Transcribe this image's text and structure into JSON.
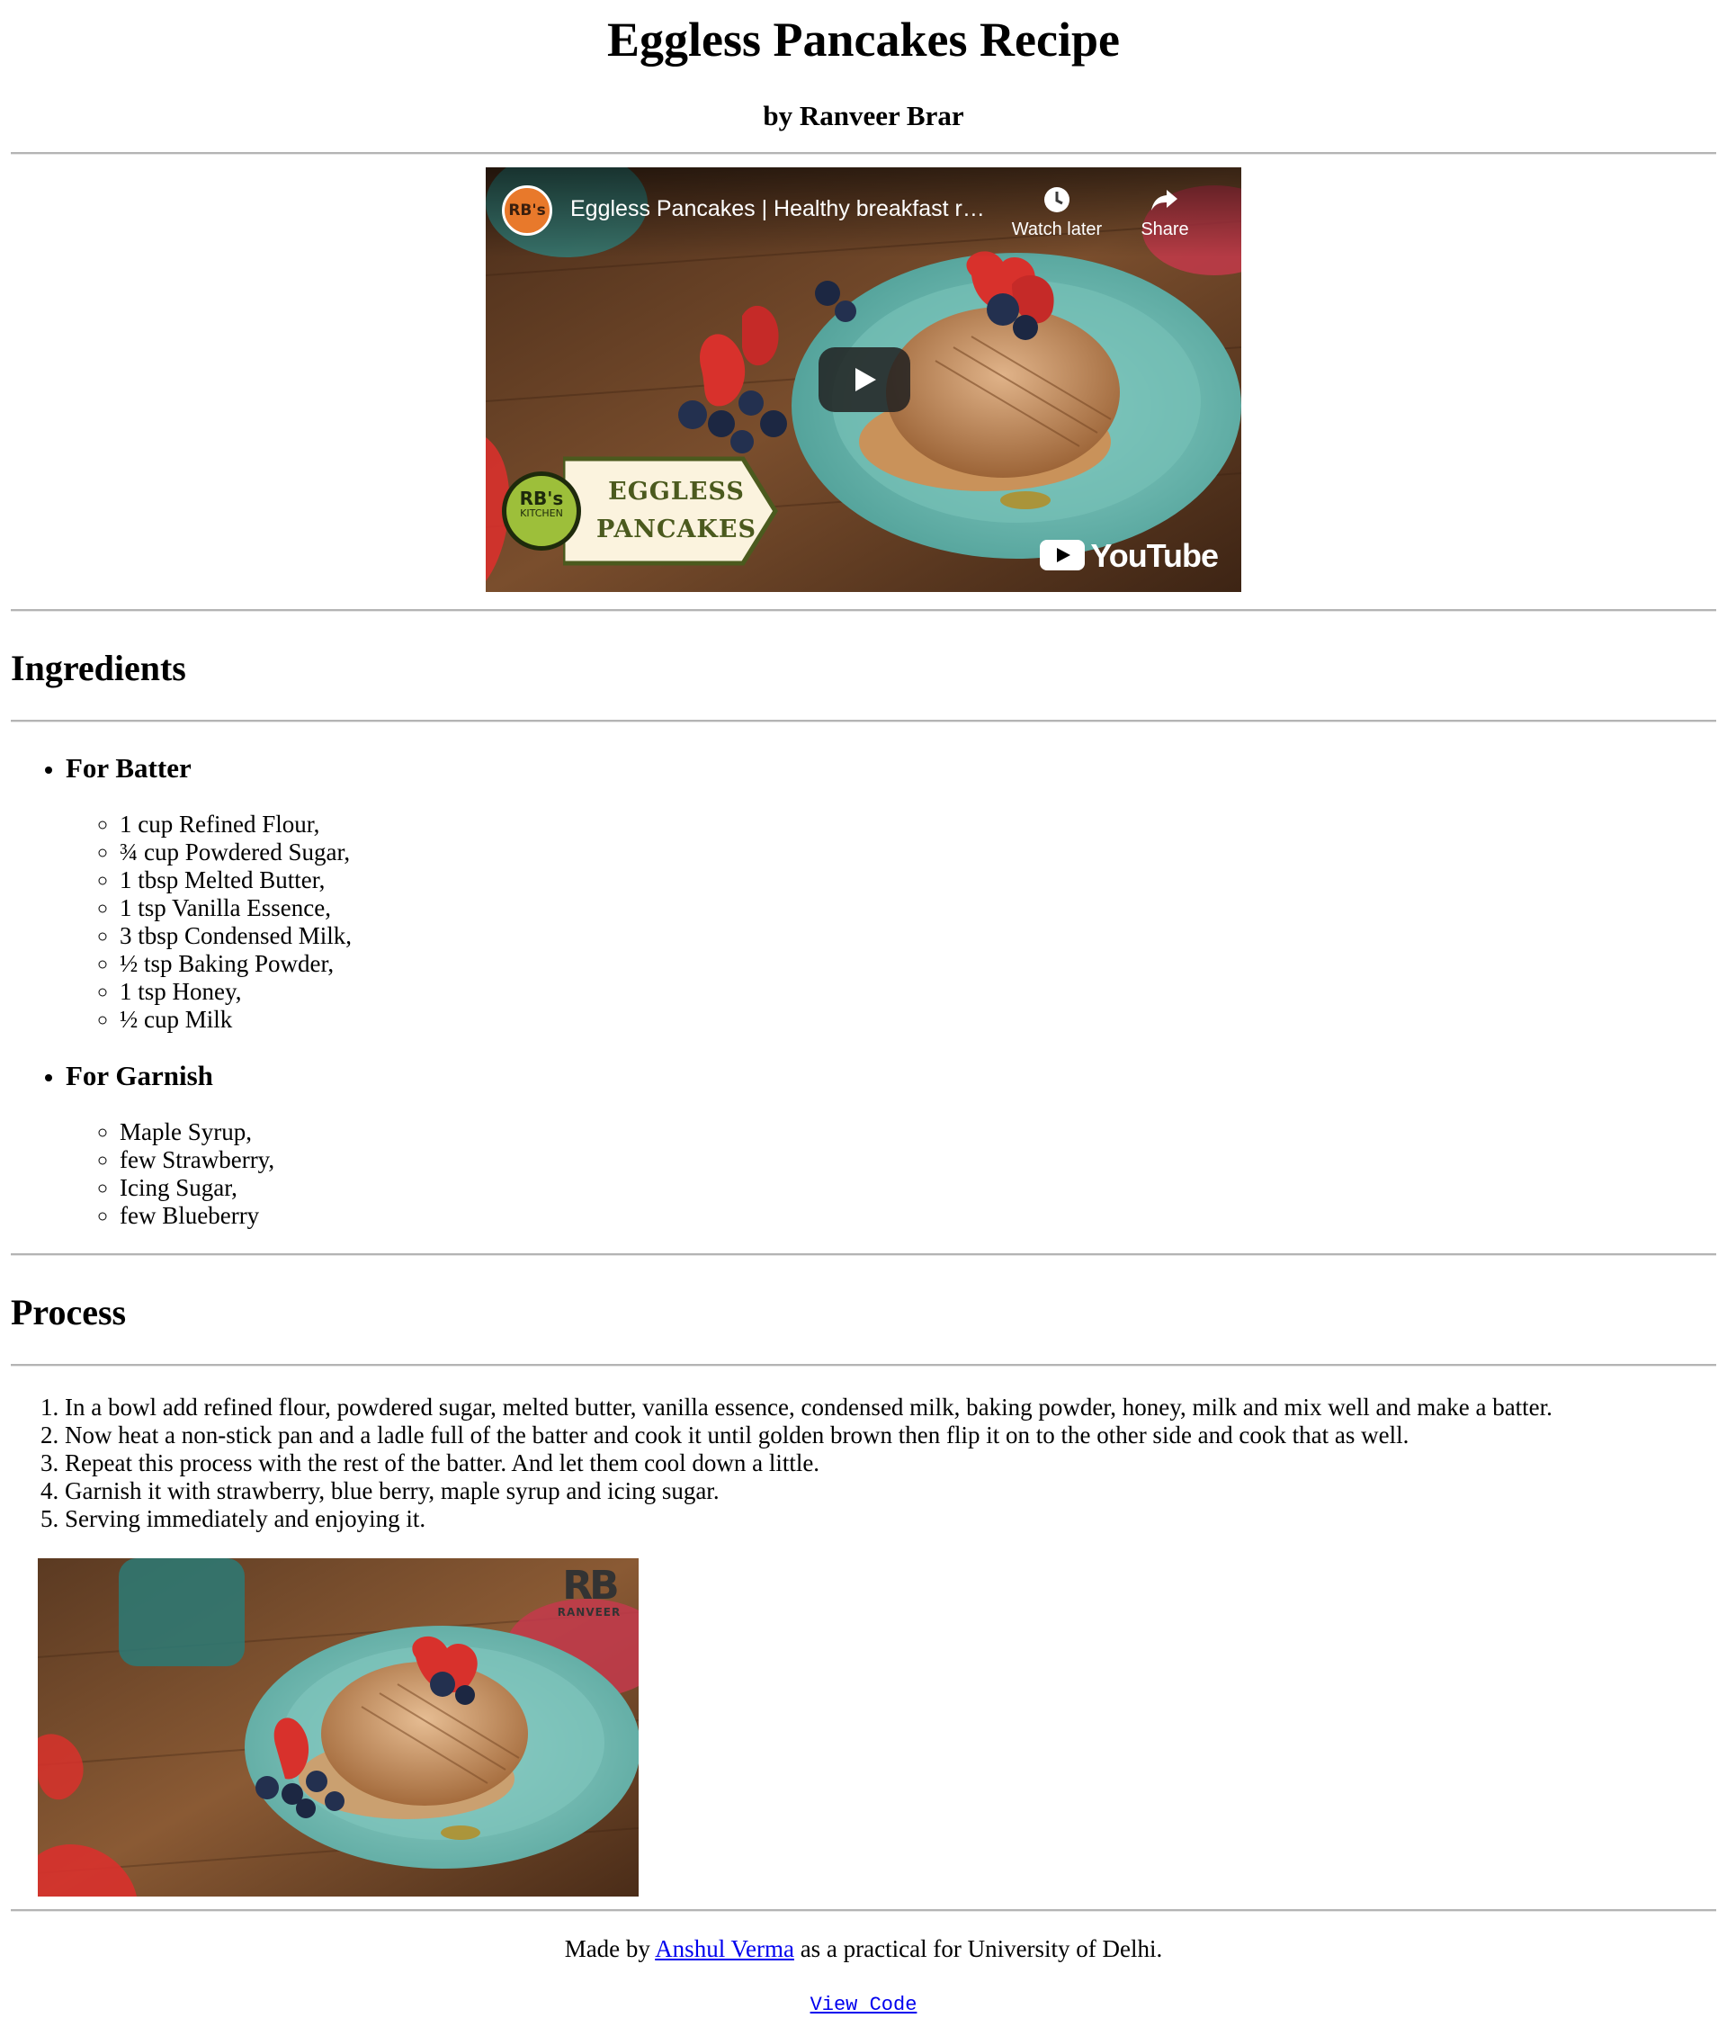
{
  "header": {
    "title": "Eggless Pancakes Recipe",
    "byline": "by Ranveer Brar"
  },
  "video": {
    "title": "Eggless Pancakes | Healthy breakfast r…",
    "channel_avatar": "RB's",
    "watch_later_label": "Watch later",
    "share_label": "Share",
    "youtube_label": "YouTube",
    "banner_logo_top": "RB's",
    "banner_logo_bottom": "KITCHEN",
    "banner_line1": "EGGLESS",
    "banner_line2": "PANCAKES",
    "icons": {
      "watch_later": "clock-icon",
      "share": "share-arrow-icon",
      "play": "play-icon"
    }
  },
  "ingredients": {
    "heading": "Ingredients",
    "groups": [
      {
        "title": "For Batter",
        "items": [
          "1 cup Refined Flour,",
          "¾ cup Powdered Sugar,",
          "1 tbsp Melted Butter,",
          "1 tsp Vanilla Essence,",
          "3 tbsp Condensed Milk,",
          "½ tsp Baking Powder,",
          "1 tsp Honey,",
          "½ cup Milk"
        ]
      },
      {
        "title": "For Garnish",
        "items": [
          "Maple Syrup,",
          "few Strawberry,",
          "Icing Sugar,",
          "few Blueberry"
        ]
      }
    ]
  },
  "process": {
    "heading": "Process",
    "steps": [
      "In a bowl add refined flour, powdered sugar, melted butter, vanilla essence, condensed milk, baking powder, honey, milk and mix well and make a batter.",
      "Now heat a non-stick pan and a ladle full of the batter and cook it until golden brown then flip it on to the other side and cook that as well.",
      "Repeat this process with the rest of the batter. And let them cool down a little.",
      "Garnish it with strawberry, blue berry, maple syrup and icing sugar.",
      "Serving immediately and enjoying it."
    ],
    "photo_watermark_mark": "RB",
    "photo_watermark_text": "RANVEER"
  },
  "footer": {
    "prefix": "Made by ",
    "author_link": "Anshul Verma",
    "suffix": " as a practical for University of Delhi.",
    "view_code_link": "View Code"
  },
  "colors": {
    "link": "#0000ee",
    "rule": "#b4b4b4",
    "plate": "#7cc5bd",
    "pancake": "#c98a4f",
    "strawberry": "#d8312c",
    "blueberry": "#23304f"
  }
}
